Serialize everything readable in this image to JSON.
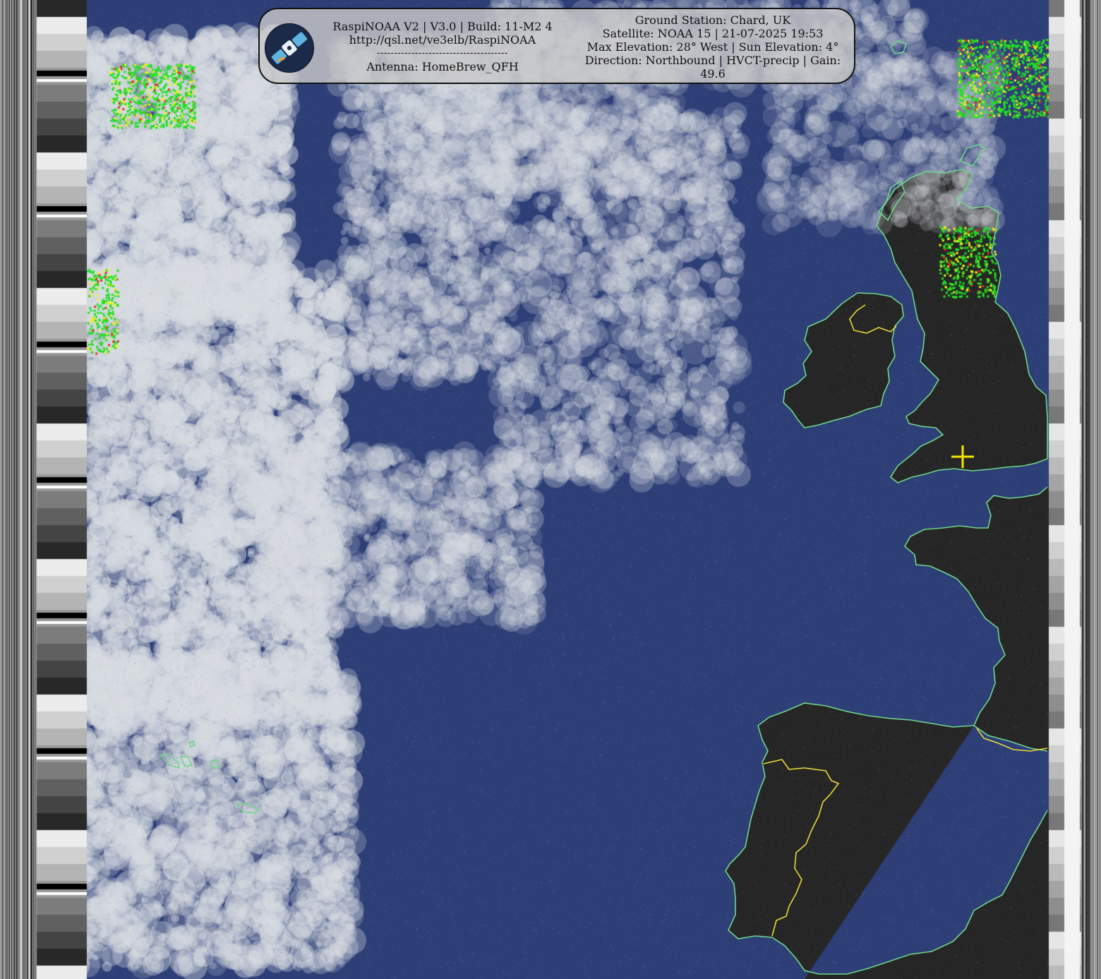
{
  "banner": {
    "left": {
      "line1": "RaspiNOAA V2 | V3.0 | Build: 11-M2 4",
      "line2": "http://qsl.net/ve3elb/RaspiNOAA",
      "separator": "--------------------------------------",
      "line3": "Antenna: HomeBrew_QFH"
    },
    "right": {
      "line1": "Ground Station: Chard, UK",
      "line2": "Satellite: NOAA 15 | 21-07-2025 19:53",
      "line3": "Max Elevation: 28° West | Sun Elevation: 4°",
      "line4": "Direction: Northbound | HVCT-precip | Gain: 49.6"
    },
    "logo_icon": "satellite-icon"
  },
  "colors": {
    "ocean": "#2e3f78",
    "land": "#262626",
    "coastline": "#6fd68a",
    "border": "#e8d83a",
    "cloud": "#d8dce2",
    "precip_green": "#22e022",
    "precip_yellow": "#f0f020",
    "precip_red": "#e03020",
    "station_marker": "#f5e500",
    "banner_bg": "#c8c8c8"
  }
}
